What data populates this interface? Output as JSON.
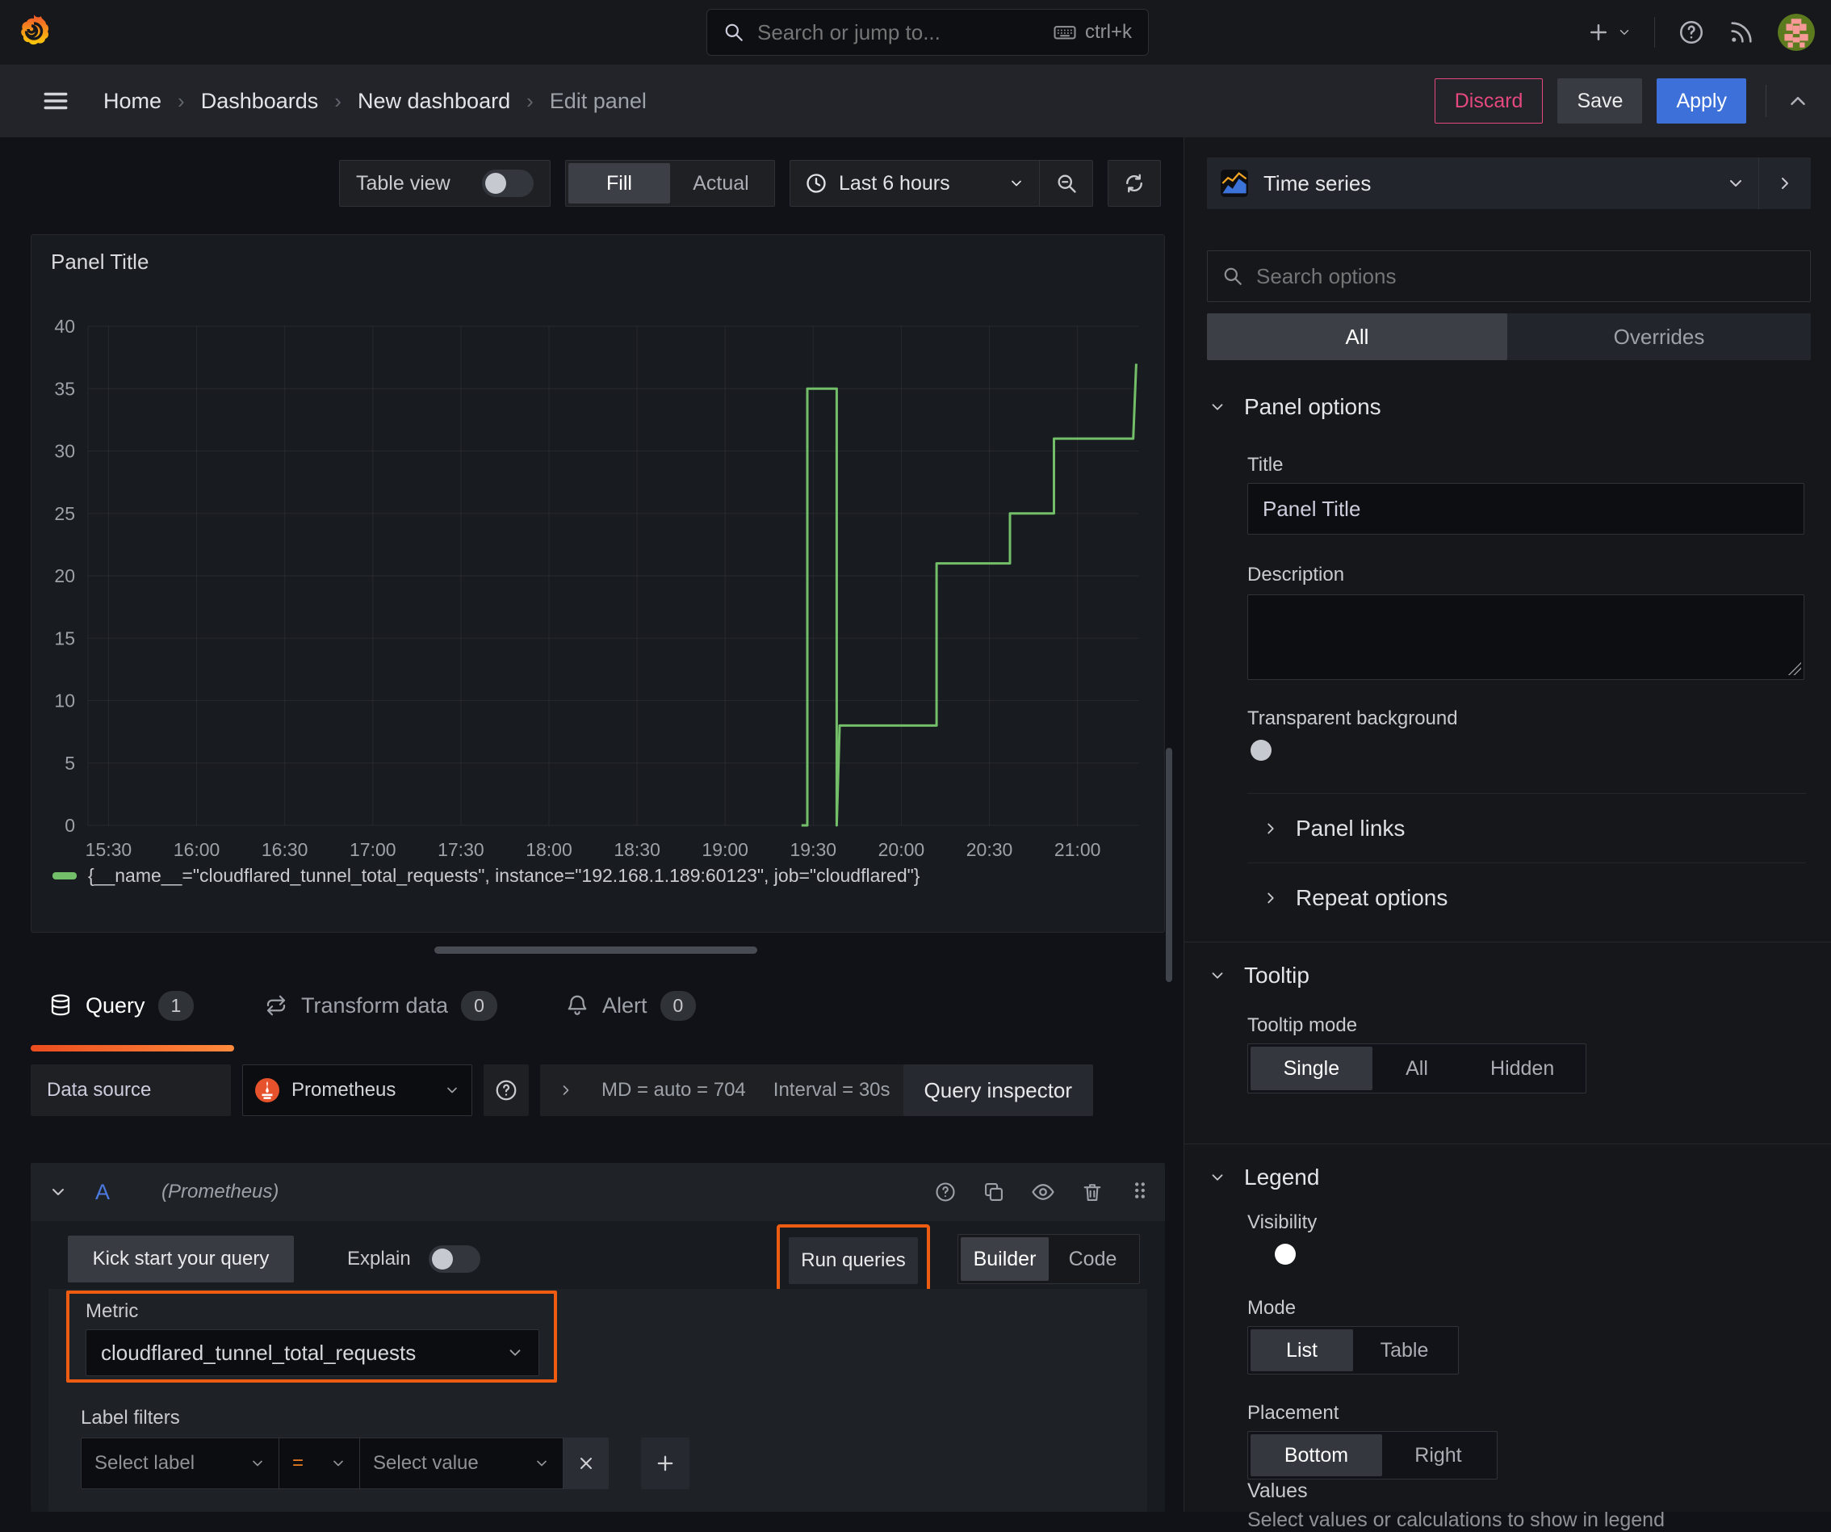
{
  "topbar": {
    "search_placeholder": "Search or jump to...",
    "search_shortcut": "ctrl+k"
  },
  "breadcrumb": {
    "items": [
      {
        "label": "Home"
      },
      {
        "label": "Dashboards"
      },
      {
        "label": "New dashboard"
      },
      {
        "label": "Edit panel"
      }
    ]
  },
  "header_actions": {
    "discard": "Discard",
    "save": "Save",
    "apply": "Apply"
  },
  "panel_toolbar": {
    "table_view": "Table view",
    "fill": "Fill",
    "actual": "Actual",
    "display_selected": "Fill",
    "time_range": "Last 6 hours"
  },
  "panel": {
    "title": "Panel Title"
  },
  "chart_data": {
    "type": "line",
    "title": "Panel Title",
    "x_ticks": [
      "15:30",
      "16:00",
      "16:30",
      "17:00",
      "17:30",
      "18:00",
      "18:30",
      "19:00",
      "19:30",
      "20:00",
      "20:30",
      "21:00"
    ],
    "x_domain": [
      "15:23",
      "21:21"
    ],
    "y_ticks": [
      0,
      5,
      10,
      15,
      20,
      25,
      30,
      35,
      40
    ],
    "ylim": [
      0,
      40
    ],
    "grid": true,
    "legend_position": "bottom",
    "series": [
      {
        "name": "{__name__=\"cloudflared_tunnel_total_requests\", instance=\"192.168.1.189:60123\", job=\"cloudflared\"}",
        "color": "#73bf69",
        "points": [
          {
            "time": "19:26",
            "value": 0
          },
          {
            "time": "19:28",
            "value": 0
          },
          {
            "time": "19:28",
            "value": 35
          },
          {
            "time": "19:38",
            "value": 35
          },
          {
            "time": "19:38",
            "value": 0
          },
          {
            "time": "19:39",
            "value": 8
          },
          {
            "time": "20:12",
            "value": 8
          },
          {
            "time": "20:12",
            "value": 21
          },
          {
            "time": "20:37",
            "value": 21
          },
          {
            "time": "20:37",
            "value": 25
          },
          {
            "time": "20:52",
            "value": 25
          },
          {
            "time": "20:52",
            "value": 31
          },
          {
            "time": "21:19",
            "value": 31
          },
          {
            "time": "21:20",
            "value": 37
          }
        ]
      }
    ]
  },
  "editor_tabs": {
    "query": {
      "label": "Query",
      "count": "1"
    },
    "transform": {
      "label": "Transform data",
      "count": "0"
    },
    "alert": {
      "label": "Alert",
      "count": "0"
    }
  },
  "datasource_row": {
    "label": "Data source",
    "name": "Prometheus",
    "stats": "MD = auto = 704",
    "interval": "Interval = 30s",
    "inspector": "Query inspector"
  },
  "query_row": {
    "ref_id": "A",
    "datasource_hint": "(Prometheus)"
  },
  "query_toolbar": {
    "kick_start": "Kick start your query",
    "explain": "Explain",
    "run_queries": "Run queries",
    "builder": "Builder",
    "code": "Code",
    "mode_selected": "Builder"
  },
  "query_builder": {
    "metric_label": "Metric",
    "metric_value": "cloudflared_tunnel_total_requests",
    "filters_label": "Label filters",
    "select_label_placeholder": "Select label",
    "operator": "=",
    "select_value_placeholder": "Select value"
  },
  "options_pane": {
    "visualization": "Time series",
    "search_placeholder": "Search options",
    "tab_all": "All",
    "tab_overrides": "Overrides",
    "tab_selected": "All",
    "panel_options": {
      "heading": "Panel options",
      "title_label": "Title",
      "title_value": "Panel Title",
      "description_label": "Description",
      "transparent_label": "Transparent background",
      "panel_links": "Panel links",
      "repeat_options": "Repeat options"
    },
    "tooltip": {
      "heading": "Tooltip",
      "mode_label": "Tooltip mode",
      "single": "Single",
      "all": "All",
      "hidden": "Hidden",
      "selected": "Single"
    },
    "legend": {
      "heading": "Legend",
      "visibility_label": "Visibility",
      "mode_label": "Mode",
      "list": "List",
      "table": "Table",
      "mode_selected": "List",
      "placement_label": "Placement",
      "bottom": "Bottom",
      "right": "Right",
      "placement_selected": "Bottom",
      "values_label": "Values",
      "values_hint": "Select values or calculations to show in legend"
    }
  },
  "icons": {
    "close": "✕",
    "plus": "+",
    "breadcrumb_separator": "›"
  }
}
